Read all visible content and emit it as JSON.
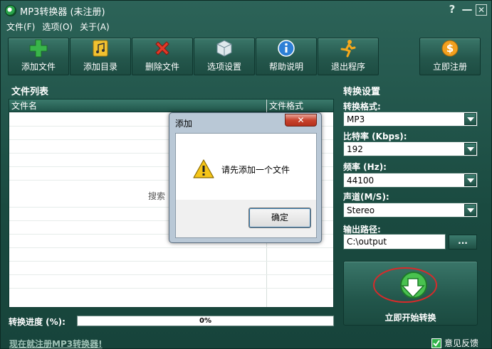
{
  "window": {
    "title": "MP3转换器 (未注册)",
    "help": "?",
    "minimize": "—",
    "close": "✕"
  },
  "menu": [
    "文件(F)",
    "选项(O)",
    "关于(A)"
  ],
  "toolbar": {
    "add_file": "添加文件",
    "add_folder": "添加目录",
    "delete_file": "删除文件",
    "options": "选项设置",
    "help": "帮助说明",
    "exit": "退出程序",
    "register": "立即注册"
  },
  "file_list": {
    "title": "文件列表",
    "col_name": "文件名",
    "col_format": "文件格式",
    "hint": "搜索"
  },
  "progress": {
    "label": "转换进度 (%):",
    "value": 0,
    "text": "0%"
  },
  "settings": {
    "title": "转换设置",
    "format_label": "转换格式:",
    "format_value": "MP3",
    "bitrate_label": "比特率 (Kbps):",
    "bitrate_value": "192",
    "freq_label": "频率 (Hz):",
    "freq_value": "44100",
    "channel_label": "声道(M/S):",
    "channel_value": "Stereo",
    "output_label": "输出路径:",
    "output_value": "C:\\output",
    "browse": "...",
    "start": "立即开始转换"
  },
  "status": {
    "register_link": "现在就注册MP3转换器!",
    "feedback": "意见反馈"
  },
  "dialog": {
    "title": "添加",
    "close": "✕",
    "message": "请先添加一个文件",
    "ok": "确定"
  },
  "colors": {
    "window_bg": "#1f4d44",
    "progress_fill": "#3aa856",
    "dialog_close": "#c8432d"
  }
}
